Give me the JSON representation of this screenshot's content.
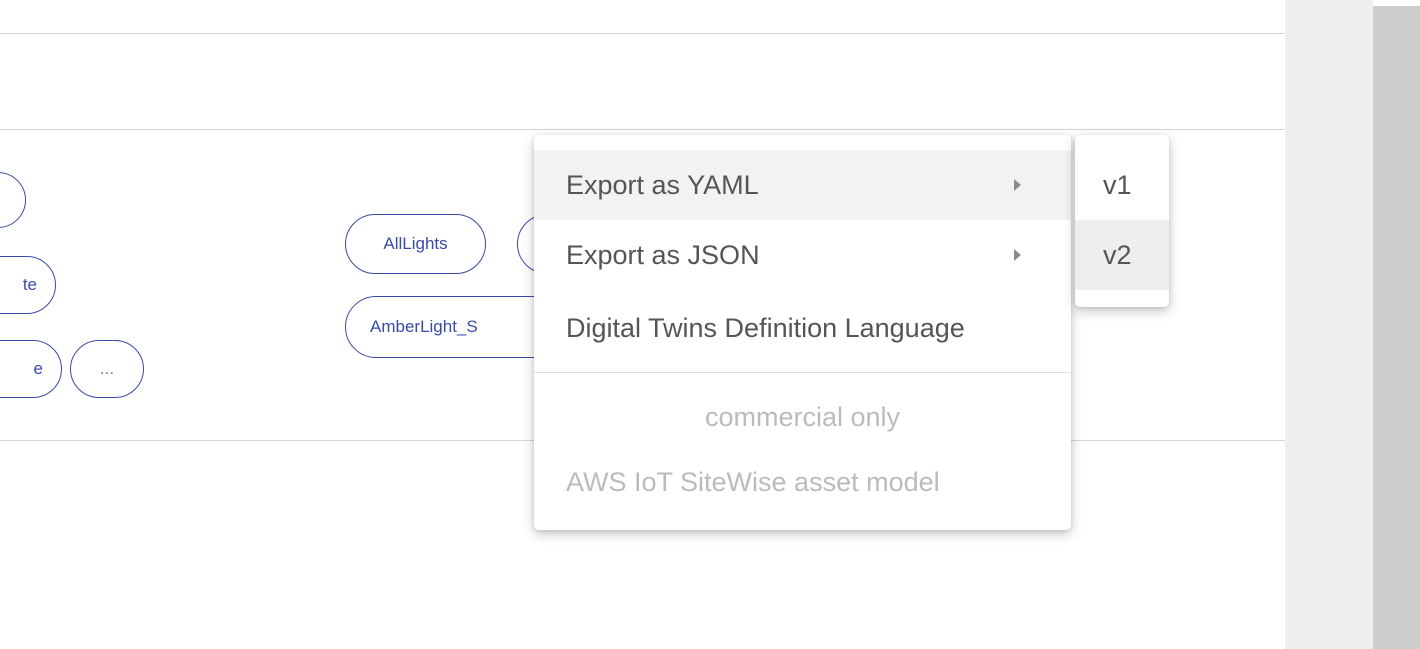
{
  "chips_left": {
    "row1": "",
    "row2": "te",
    "row3a": "e",
    "row3b": "..."
  },
  "chips_middle": {
    "alllights": "AllLights",
    "amberlight": "AmberLight_S"
  },
  "context_menu": {
    "items": [
      {
        "label": "Export as YAML",
        "has_submenu": true,
        "state": "hovered"
      },
      {
        "label": "Export as JSON",
        "has_submenu": true,
        "state": "normal"
      },
      {
        "label": "Digital Twins Definition Language",
        "has_submenu": false,
        "state": "normal"
      }
    ],
    "section_label": "commercial only",
    "disabled_items": [
      {
        "label": "AWS IoT SiteWise asset model"
      }
    ]
  },
  "submenu": {
    "items": [
      {
        "label": "v1",
        "state": "normal"
      },
      {
        "label": "v2",
        "state": "hovered"
      }
    ]
  },
  "colors": {
    "chip_accent": "#3a4aa8",
    "menu_text": "#555555",
    "disabled_text": "#bbbbbb",
    "scrollbar": "#cdcdcd"
  }
}
